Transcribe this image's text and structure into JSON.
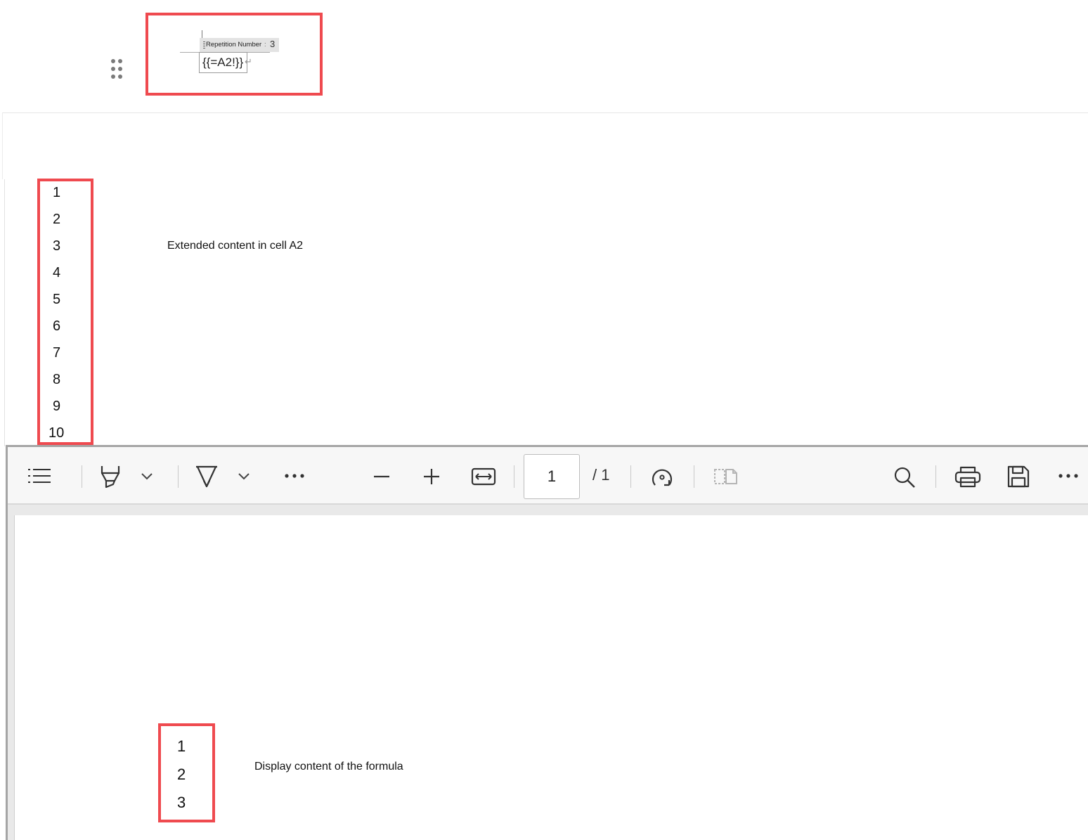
{
  "word_field": {
    "tag_label": "Repetition Number",
    "tag_value": "3",
    "formula": "{{=A2!}}"
  },
  "excel_cells": {
    "numbers": [
      "1",
      "2",
      "3",
      "4",
      "5",
      "6",
      "7",
      "8",
      "9",
      "10"
    ],
    "caption": "Extended  content in cell A2"
  },
  "pdf_viewer": {
    "toolbar": {
      "page_current": "1",
      "page_total": "/ 1"
    },
    "numbers": [
      "1",
      "2",
      "3"
    ],
    "caption": "Display content of the formula"
  },
  "colors": {
    "highlight_border": "#ef4a4f",
    "toolbar_bg": "#f7f7f7"
  }
}
